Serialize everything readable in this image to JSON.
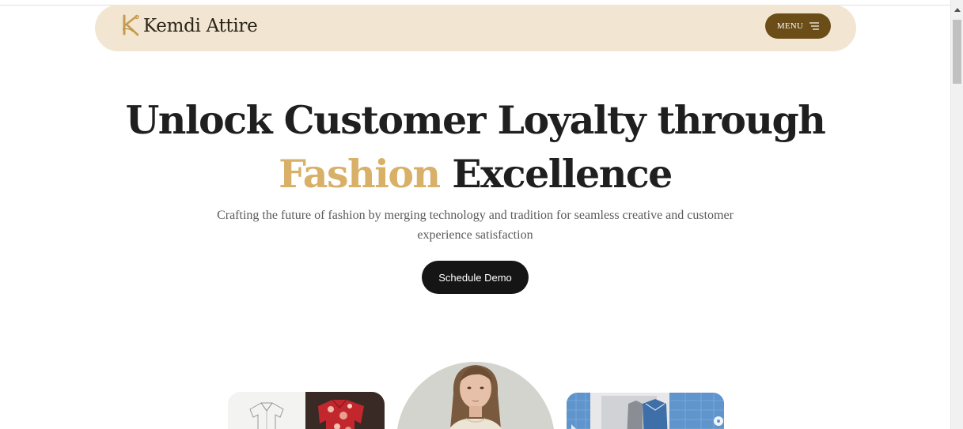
{
  "nav": {
    "brand": "Kemdi Attire",
    "menu_label": "MENU",
    "logo_icon": "k-needle-logo-icon",
    "menu_icon": "hamburger-icon"
  },
  "hero": {
    "title_line1": "Unlock Customer Loyalty through",
    "title_accent": "Fashion",
    "title_line2_rest": "Excellence",
    "subtitle": "Crafting the future of fashion by merging technology and tradition for seamless creative and customer experience satisfaction",
    "cta_label": "Schedule Demo"
  },
  "gallery": {
    "images": [
      "garment-sketch-and-floral-shirt",
      "model-portrait",
      "digital-garment-design"
    ]
  },
  "colors": {
    "nav_background": "#f2e6d2",
    "menu_button": "#6b4d18",
    "accent": "#d8b067",
    "cta_background": "#151515",
    "text_dark": "#1f1f1f"
  }
}
